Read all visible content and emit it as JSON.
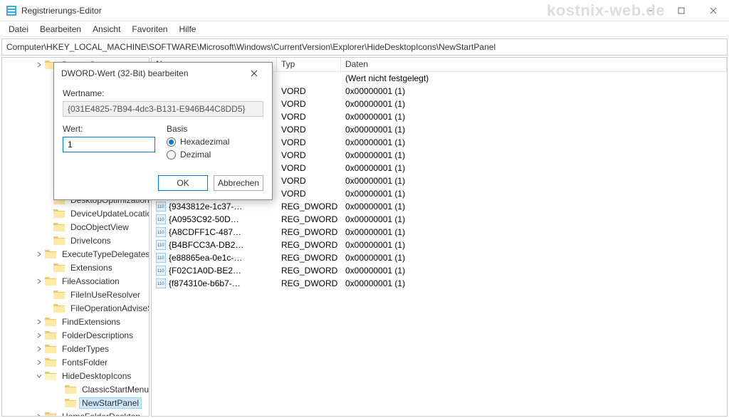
{
  "window": {
    "title": "Registrierungs-Editor",
    "watermark": "kostnix-web.de"
  },
  "menu": {
    "file": "Datei",
    "edit": "Bearbeiten",
    "view": "Ansicht",
    "favorites": "Favoriten",
    "help": "Hilfe"
  },
  "pathbar": "Computer\\HKEY_LOCAL_MACHINE\\SOFTWARE\\Microsoft\\Windows\\CurrentVersion\\Explorer\\HideDesktopIcons\\NewStartPanel",
  "list": {
    "headers": {
      "name": "Name",
      "type": "Typ",
      "data": "Daten"
    },
    "default_data": "(Wert nicht festgelegt)",
    "rows": [
      {
        "name": "",
        "type": "",
        "data": "(Wert nicht festgelegt)",
        "hidden": true
      },
      {
        "name": "",
        "type": "VORD",
        "data": "0x00000001 (1)",
        "clipped": true
      },
      {
        "name": "",
        "type": "VORD",
        "data": "0x00000001 (1)",
        "clipped": true
      },
      {
        "name": "",
        "type": "VORD",
        "data": "0x00000001 (1)",
        "clipped": true
      },
      {
        "name": "",
        "type": "VORD",
        "data": "0x00000001 (1)",
        "clipped": true
      },
      {
        "name": "",
        "type": "VORD",
        "data": "0x00000001 (1)",
        "clipped": true
      },
      {
        "name": "",
        "type": "VORD",
        "data": "0x00000001 (1)",
        "clipped": true
      },
      {
        "name": "",
        "type": "VORD",
        "data": "0x00000001 (1)",
        "clipped": true
      },
      {
        "name": "",
        "type": "VORD",
        "data": "0x00000001 (1)",
        "clipped": true
      },
      {
        "name": "",
        "type": "VORD",
        "data": "0x00000001 (1)",
        "clipped": true
      },
      {
        "name": "{9343812e-1c37-…",
        "type": "REG_DWORD",
        "data": "0x00000001 (1)"
      },
      {
        "name": "{A0953C92-50D…",
        "type": "REG_DWORD",
        "data": "0x00000001 (1)"
      },
      {
        "name": "{A8CDFF1C-487…",
        "type": "REG_DWORD",
        "data": "0x00000001 (1)"
      },
      {
        "name": "{B4BFCC3A-DB2…",
        "type": "REG_DWORD",
        "data": "0x00000001 (1)"
      },
      {
        "name": "{e88865ea-0e1c-…",
        "type": "REG_DWORD",
        "data": "0x00000001 (1)"
      },
      {
        "name": "{F02C1A0D-BE2…",
        "type": "REG_DWORD",
        "data": "0x00000001 (1)"
      },
      {
        "name": "{f874310e-b6b7-…",
        "type": "REG_DWORD",
        "data": "0x00000001 (1)"
      }
    ]
  },
  "tree": {
    "top": "BannerStore",
    "items": [
      {
        "label": "DesktopOptimization",
        "indent": 58,
        "exp": ""
      },
      {
        "label": "DeviceUpdateLocatior",
        "indent": 58,
        "exp": ""
      },
      {
        "label": "DocObjectView",
        "indent": 58,
        "exp": ""
      },
      {
        "label": "DriveIcons",
        "indent": 58,
        "exp": ""
      },
      {
        "label": "ExecuteTypeDelegates",
        "indent": 46,
        "exp": ">"
      },
      {
        "label": "Extensions",
        "indent": 58,
        "exp": ""
      },
      {
        "label": "FileAssociation",
        "indent": 46,
        "exp": ">"
      },
      {
        "label": "FileInUseResolver",
        "indent": 58,
        "exp": ""
      },
      {
        "label": "FileOperationAdviseSi",
        "indent": 58,
        "exp": ""
      },
      {
        "label": "FindExtensions",
        "indent": 46,
        "exp": ">"
      },
      {
        "label": "FolderDescriptions",
        "indent": 46,
        "exp": ">"
      },
      {
        "label": "FolderTypes",
        "indent": 46,
        "exp": ">"
      },
      {
        "label": "FontsFolder",
        "indent": 46,
        "exp": ">"
      },
      {
        "label": "HideDesktopIcons",
        "indent": 46,
        "exp": "v",
        "open": true
      },
      {
        "label": "ClassicStartMenu",
        "indent": 74,
        "exp": ""
      },
      {
        "label": "NewStartPanel",
        "indent": 74,
        "exp": "",
        "selected": true
      },
      {
        "label": "HomeFolderDesktop",
        "indent": 46,
        "exp": ">"
      }
    ]
  },
  "dialog": {
    "title": "DWORD-Wert (32-Bit) bearbeiten",
    "name_label": "Wertname:",
    "name_value": "{031E4825-7B94-4dc3-B131-E946B44C8DD5}",
    "value_label": "Wert:",
    "value_input": "1",
    "basis_label": "Basis",
    "radio_hex": "Hexadezimal",
    "radio_dec": "Dezimal",
    "ok": "OK",
    "cancel": "Abbrechen"
  }
}
